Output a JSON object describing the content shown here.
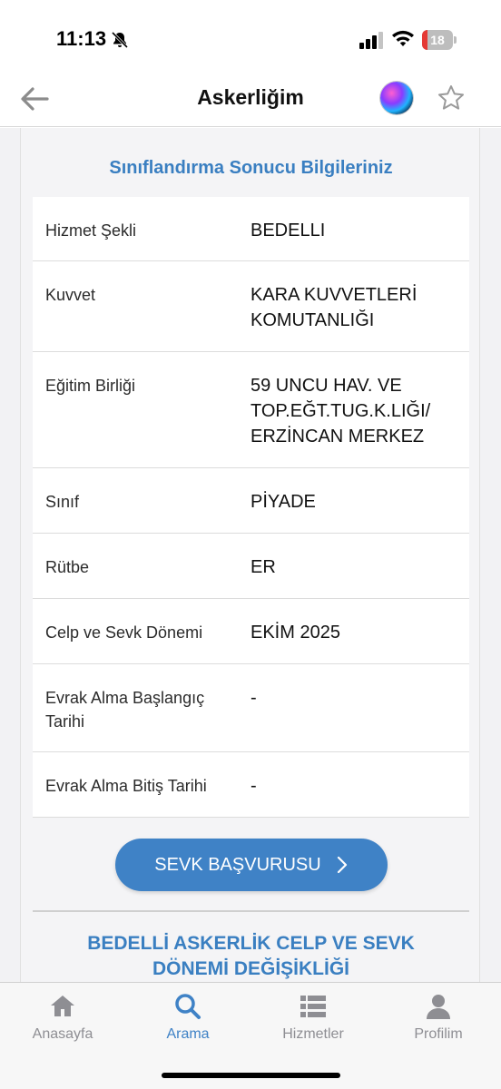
{
  "status_bar": {
    "time": "11:13",
    "battery_level": "18",
    "battery_fraction": 0.18
  },
  "nav": {
    "title": "Askerliğim"
  },
  "section_title": "Sınıflandırma Sonucu Bilgileriniz",
  "rows": [
    {
      "label": "Hizmet Şekli",
      "value": "BEDELLI"
    },
    {
      "label": "Kuvvet",
      "value": "KARA KUVVETLERİ KOMUTANLIĞI"
    },
    {
      "label": "Eğitim Birliği",
      "value": "59 UNCU HAV. VE TOP.EĞT.TUG.K.LIĞI/ ERZİNCAN MERKEZ"
    },
    {
      "label": "Sınıf",
      "value": "PİYADE"
    },
    {
      "label": "Rütbe",
      "value": "ER"
    },
    {
      "label": "Celp ve Sevk Dönemi",
      "value": "EKİM 2025"
    },
    {
      "label": "Evrak Alma Başlangıç Tarihi",
      "value": "-"
    },
    {
      "label": "Evrak Alma Bitiş Tarihi",
      "value": "-"
    }
  ],
  "button": {
    "label": "SEVK BAŞVURUSU"
  },
  "bottom_title": "BEDELLİ ASKERLİK CELP VE SEVK DÖNEMİ DEĞİŞİKLİĞİ",
  "tabs": [
    {
      "label": "Anasayfa",
      "icon": "home-icon",
      "active": false
    },
    {
      "label": "Arama",
      "icon": "search-icon",
      "active": true
    },
    {
      "label": "Hizmetler",
      "icon": "list-icon",
      "active": false
    },
    {
      "label": "Profilim",
      "icon": "profile-icon",
      "active": false
    }
  ],
  "colors": {
    "accent": "#3f82c6",
    "title_blue": "#3a7fc1",
    "tab_inactive": "#8e8e93"
  }
}
